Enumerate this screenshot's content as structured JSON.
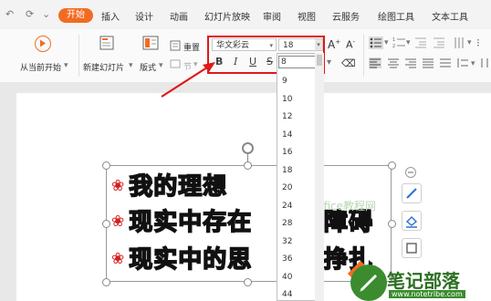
{
  "quick_access": {
    "redo": "⟳",
    "more": "⌄"
  },
  "tabs": {
    "active": "开始",
    "items": [
      "插入",
      "设计",
      "动画",
      "幻灯片放映",
      "审阅",
      "视图",
      "云服务",
      "绘图工具",
      "文本工具"
    ]
  },
  "ribbon": {
    "play_from_current": "从当前开始",
    "new_slide": "新建幻灯片",
    "layout": "版式",
    "reset": "重置",
    "section": "节"
  },
  "font": {
    "family": "华文彩云",
    "size": "18",
    "bold": "B",
    "italic": "I",
    "underline": "U",
    "strike": "S"
  },
  "size_dropdown": {
    "current_input": "8",
    "options": [
      "9",
      "10",
      "12",
      "14",
      "16",
      "18",
      "20",
      "24",
      "28",
      "32",
      "36",
      "40",
      "44"
    ]
  },
  "slide": {
    "lines": [
      "我的理想",
      "现实中存在",
      "障碍",
      "现实中的思",
      "挣扎"
    ]
  },
  "watermark": {
    "brand": "笔记部落",
    "url": "www.notetribe.com",
    "faded": "Office教程网"
  },
  "colors": {
    "accent": "#f26b22",
    "highlight": "#e01818",
    "bullet": "#d42020"
  }
}
